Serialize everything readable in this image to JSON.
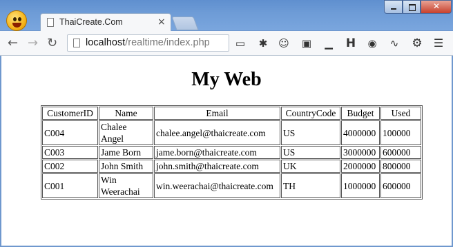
{
  "browser": {
    "tab": {
      "title": "ThaiCreate.Com",
      "close_glyph": "×"
    },
    "url": {
      "host": "localhost",
      "path": "/realtime/index.php"
    },
    "nav": {
      "back": "←",
      "forward": "→",
      "reload": "↻"
    },
    "extensions": [
      {
        "name": "window-icon",
        "glyph": "▭"
      },
      {
        "name": "bug-icon",
        "glyph": "✱"
      },
      {
        "name": "emoji-icon",
        "glyph": "☺"
      },
      {
        "name": "screenshot-icon",
        "glyph": "▣"
      },
      {
        "name": "ruler-icon",
        "glyph": "▁"
      },
      {
        "name": "h-icon",
        "glyph": "H"
      },
      {
        "name": "circle-icon",
        "glyph": "◉"
      },
      {
        "name": "pulse-icon",
        "glyph": "∿"
      },
      {
        "name": "gear-icon",
        "glyph": "⚙"
      },
      {
        "name": "menu-icon",
        "glyph": "☰"
      }
    ]
  },
  "page": {
    "heading": "My Web",
    "table": {
      "headers": [
        "CustomerID",
        "Name",
        "Email",
        "CountryCode",
        "Budget",
        "Used"
      ],
      "rows": [
        [
          "C004",
          "Chalee Angel",
          "chalee.angel@thaicreate.com",
          "US",
          "4000000",
          "100000"
        ],
        [
          "C003",
          "Jame Born",
          "jame.born@thaicreate.com",
          "US",
          "3000000",
          "600000"
        ],
        [
          "C002",
          "John Smith",
          "john.smith@thaicreate.com",
          "UK",
          "2000000",
          "800000"
        ],
        [
          "C001",
          "Win Weerachai",
          "win.weerachai@thaicreate.com",
          "TH",
          "1000000",
          "600000"
        ]
      ]
    }
  }
}
